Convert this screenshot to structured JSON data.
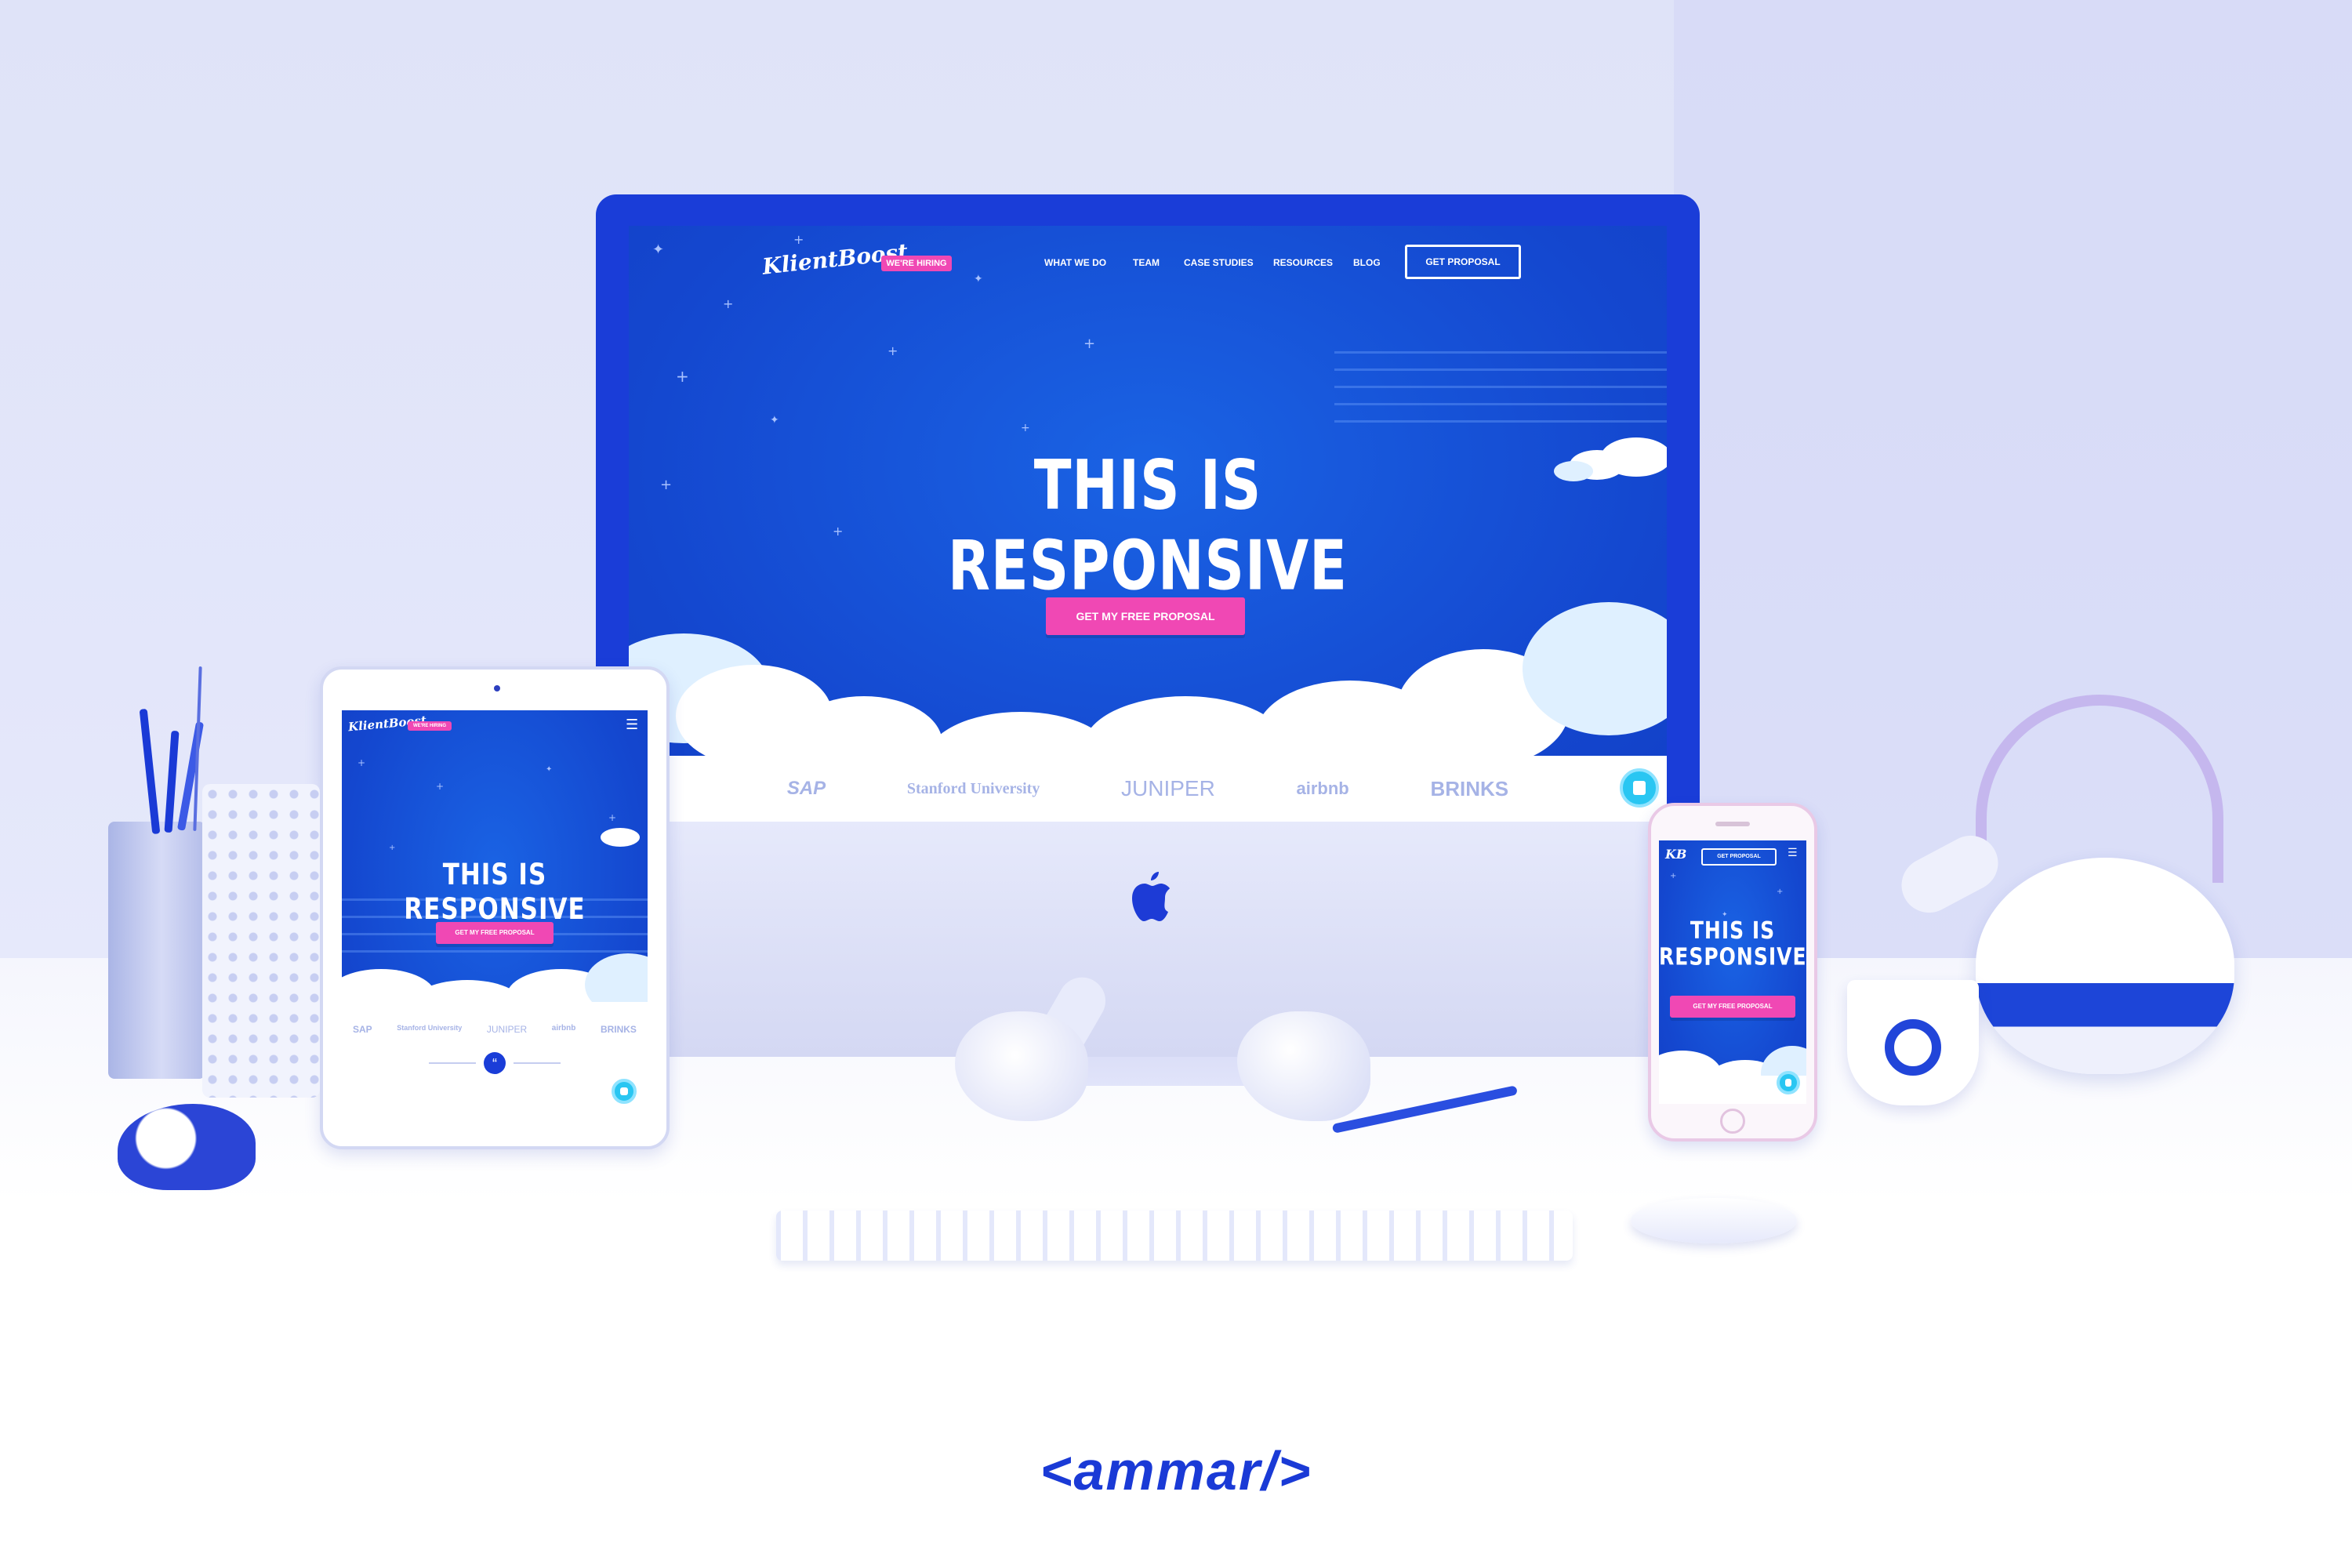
{
  "brand": {
    "logo_text": "KlientBoost",
    "hiring_tag": "WE'RE HIRING",
    "short_logo": "KB"
  },
  "nav": {
    "items": [
      "WHAT WE DO",
      "TEAM",
      "CASE STUDIES",
      "RESOURCES",
      "BLOG"
    ],
    "cta": "GET PROPOSAL"
  },
  "hero": {
    "title": "THIS IS RESPONSIVE",
    "title_line1": "THIS IS",
    "title_line2": "RESPONSIVE",
    "button": "GET MY FREE PROPOSAL"
  },
  "clients": [
    "SAP",
    "Stanford University",
    "JUNIPER",
    "airbnb",
    "BRINKS"
  ],
  "tablet": {
    "quote_icon": "quote-icon",
    "menu_icon": "hamburger-menu-icon"
  },
  "devices": [
    "imac",
    "ipad",
    "iphone"
  ],
  "footer": {
    "signature": "<ammar/>"
  },
  "colors": {
    "hero_blue": "#1552d6",
    "frame_blue": "#1a3dd8",
    "accent_pink": "#f048b4",
    "chat_cyan": "#29c6f2",
    "wall": "#dfe3f8"
  }
}
